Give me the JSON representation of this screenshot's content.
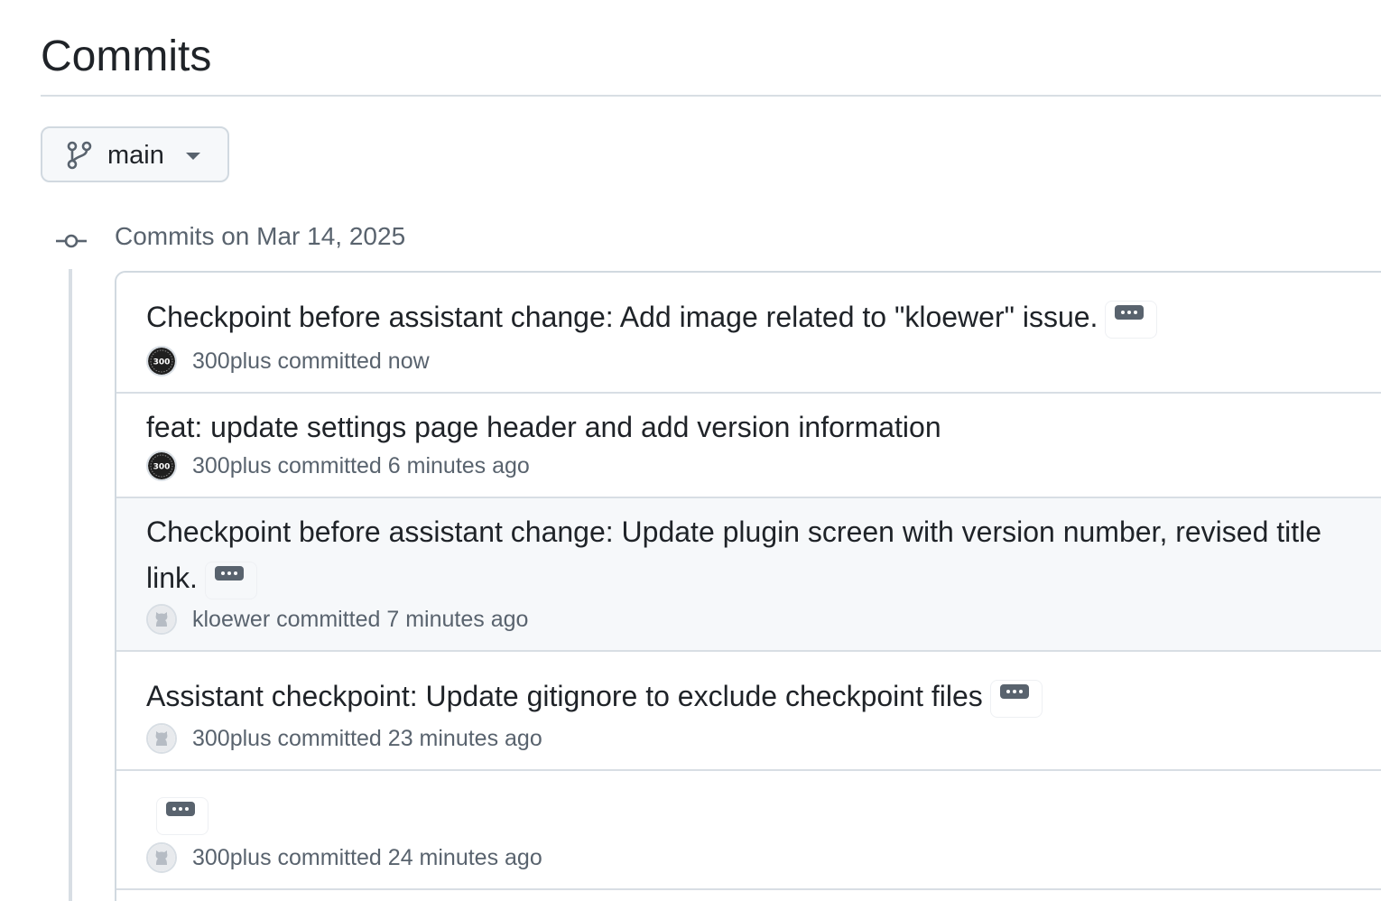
{
  "page": {
    "title": "Commits"
  },
  "branch_selector": {
    "label": "main",
    "icon": "git-branch-icon"
  },
  "commit_groups": [
    {
      "heading": "Commits on Mar 14, 2025",
      "icon": "git-commit-icon",
      "commits": [
        {
          "title": "Checkpoint before assistant change: Add image related to \"kloewer\" issue.",
          "has_ellipsis": true,
          "author": "300plus",
          "committed": "committed",
          "time": "now",
          "avatar": "300plus-avatar"
        },
        {
          "title": "feat: update settings page header and add version information",
          "has_ellipsis": false,
          "author": "300plus",
          "committed": "committed",
          "time": "6 minutes ago",
          "avatar": "300plus-avatar"
        },
        {
          "title": "Checkpoint before assistant change: Update plugin screen with version number, revised title",
          "title_line2": "link.",
          "has_ellipsis": true,
          "author": "kloewer",
          "committed": "committed",
          "time": "7 minutes ago",
          "avatar": "github-default-avatar"
        },
        {
          "title": "Assistant checkpoint: Update gitignore to exclude checkpoint files",
          "has_ellipsis": true,
          "author": "300plus",
          "committed": "committed",
          "time": "23 minutes ago",
          "avatar": "github-default-avatar"
        },
        {
          "title": "",
          "has_ellipsis": true,
          "author": "300plus",
          "committed": "committed",
          "time": "24 minutes ago",
          "avatar": "github-default-avatar"
        }
      ]
    }
  ],
  "colors": {
    "text_primary": "#1f2328",
    "text_muted": "#59636e",
    "border": "#d1d9e0",
    "hover_row": "#f6f8fa"
  }
}
